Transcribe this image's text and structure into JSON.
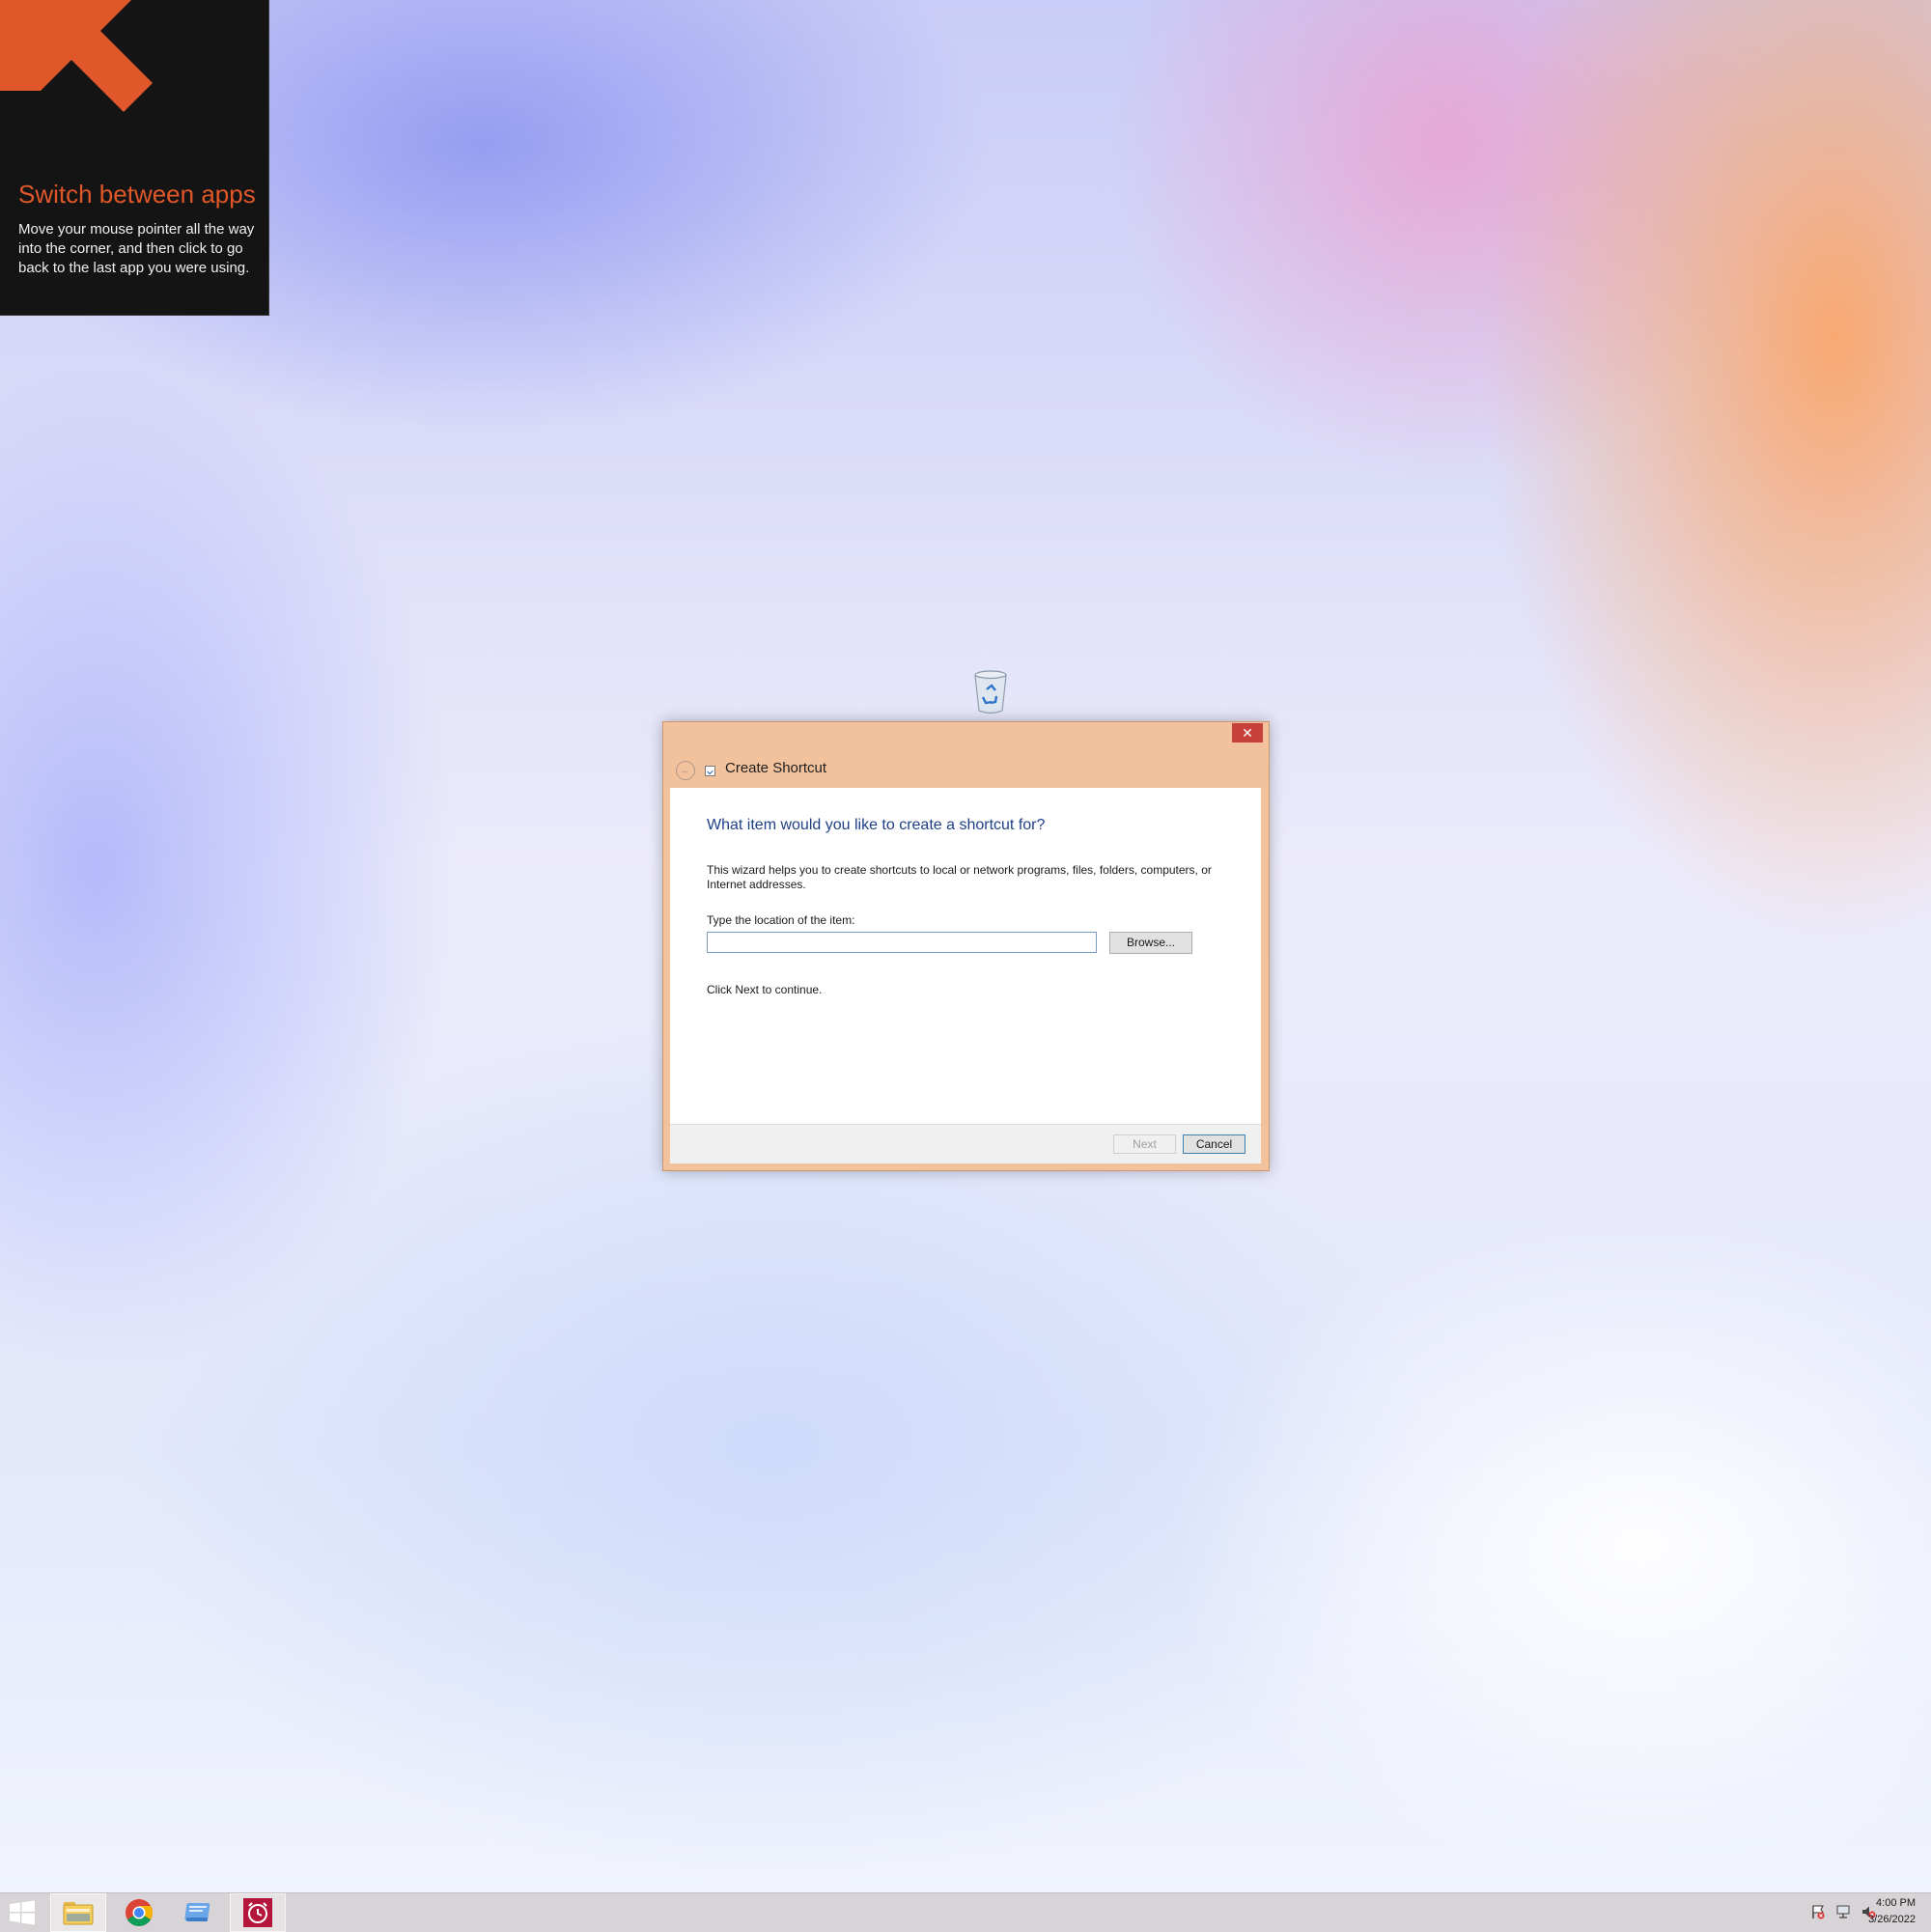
{
  "tip": {
    "title": "Switch between apps",
    "body": "Move your mouse pointer all the way into the corner, and then click to go back to the last app you were using.",
    "accent_color": "#e0572a"
  },
  "desktop": {
    "icons": [
      {
        "icon": "recycle-bin-icon"
      }
    ]
  },
  "dialog": {
    "title": "Create Shortcut",
    "close_label": "✕",
    "heading": "What item would you like to create a shortcut for?",
    "intro": "This wizard helps you to create shortcuts to local or network programs, files, folders, computers, or Internet addresses.",
    "location_label": "Type the location of the item:",
    "location_value": "",
    "browse_label": "Browse...",
    "continue_text": "Click Next to continue.",
    "next_label": "Next",
    "next_enabled": false,
    "cancel_label": "Cancel",
    "frame_color": "#f2c29c"
  },
  "taskbar": {
    "apps": [
      {
        "name": "start",
        "icon": "windows-logo-icon"
      },
      {
        "name": "file-explorer",
        "icon": "folder-icon",
        "active": true
      },
      {
        "name": "chrome",
        "icon": "chrome-icon"
      },
      {
        "name": "files",
        "icon": "file-manager-icon"
      },
      {
        "name": "alarms",
        "icon": "alarm-clock-icon",
        "active": true
      }
    ],
    "tray_icons": [
      "action-center-flag-icon",
      "network-icon",
      "volume-muted-icon"
    ],
    "time": "4:00 PM",
    "date": "3/26/2022"
  }
}
